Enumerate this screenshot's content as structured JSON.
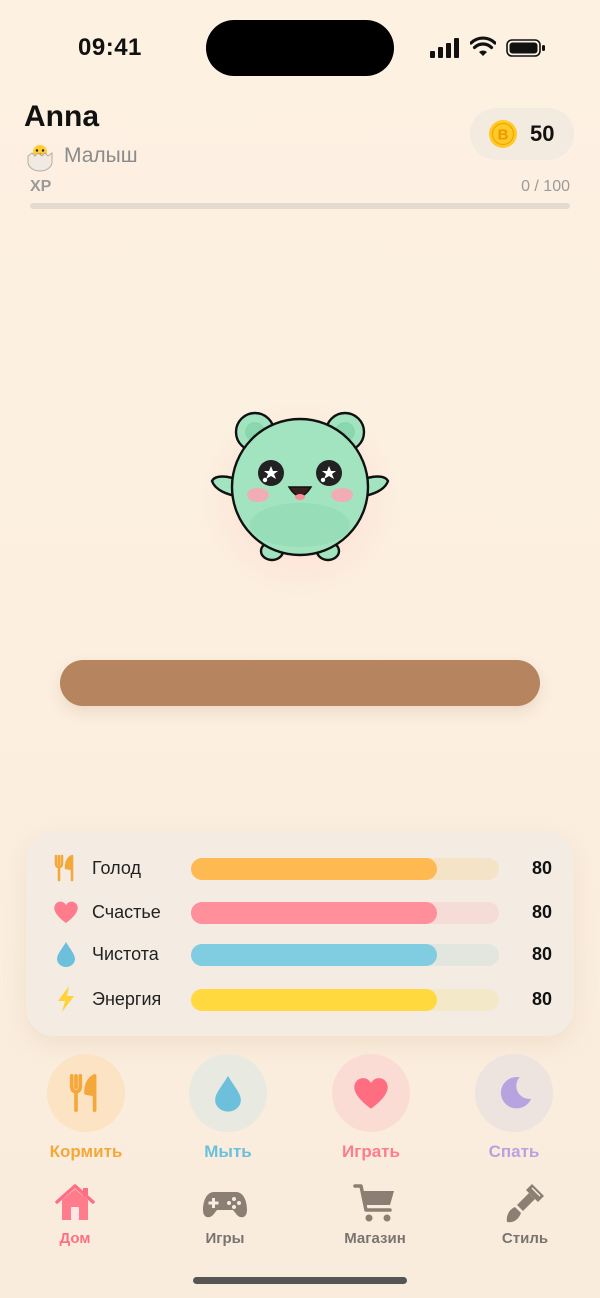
{
  "status_bar": {
    "time": "09:41"
  },
  "header": {
    "name": "Anna",
    "rank_icon": "hatching-chick-icon",
    "rank": "Малыш",
    "coins": "50",
    "coin_icon": "coin-icon",
    "coin_symbol": "B"
  },
  "xp": {
    "label": "XP",
    "value": "0 / 100",
    "progress": 0
  },
  "stats": [
    {
      "label": "Голод",
      "value": "80",
      "percent": 80,
      "icon": "fork-knife-icon",
      "color": "#ffb951",
      "track": "#f4e3c6"
    },
    {
      "label": "Счастье",
      "value": "80",
      "percent": 80,
      "icon": "heart-icon",
      "color": "#ff8f9a",
      "track": "#f6dcd7"
    },
    {
      "label": "Чистота",
      "value": "80",
      "percent": 80,
      "icon": "water-drop-icon",
      "color": "#80cce0",
      "track": "#e2e6df"
    },
    {
      "label": "Энергия",
      "value": "80",
      "percent": 80,
      "icon": "lightning-icon",
      "color": "#ffd93d",
      "track": "#f3e8c8"
    }
  ],
  "actions": [
    {
      "label": "Кормить",
      "icon": "fork-knife-icon",
      "color": "#f5a83a",
      "bg": "#fbe3c3"
    },
    {
      "label": "Мыть",
      "icon": "water-drop-icon",
      "color": "#6cc0dc",
      "bg": "#e8e9e0"
    },
    {
      "label": "Играть",
      "icon": "heart-icon",
      "color": "#ff7c8c",
      "bg": "#fbdcd5"
    },
    {
      "label": "Спать",
      "icon": "moon-icon",
      "color": "#b9a2e0",
      "bg": "#ede3df"
    }
  ],
  "tabs": [
    {
      "label": "Дом",
      "icon": "home-icon",
      "active": true
    },
    {
      "label": "Игры",
      "icon": "gamepad-icon",
      "active": false
    },
    {
      "label": "Магазин",
      "icon": "cart-icon",
      "active": false
    },
    {
      "label": "Стиль",
      "icon": "paintbrush-icon",
      "active": false
    }
  ],
  "colors": {
    "accent": "#ff7c8c",
    "inactive_tab": "#8b7e73",
    "platform": "#b68560",
    "pet_body": "#a2e4c0"
  }
}
